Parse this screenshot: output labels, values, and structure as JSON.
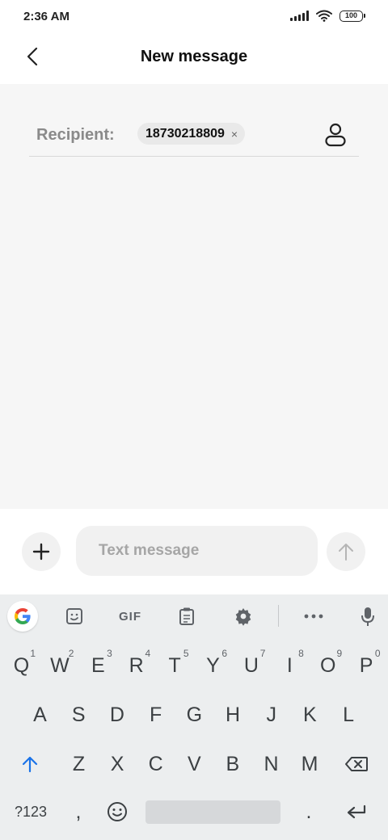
{
  "status_bar": {
    "time": "2:36 AM",
    "battery": "100"
  },
  "header": {
    "title": "New message"
  },
  "recipient": {
    "label": "Recipient:",
    "number": "18730218809",
    "remove_glyph": "×"
  },
  "composer": {
    "placeholder": "Text message"
  },
  "keyboard": {
    "toolbar": {
      "gif_label": "GIF"
    },
    "row1": [
      {
        "label": "Q",
        "hint": "1"
      },
      {
        "label": "W",
        "hint": "2"
      },
      {
        "label": "E",
        "hint": "3"
      },
      {
        "label": "R",
        "hint": "4"
      },
      {
        "label": "T",
        "hint": "5"
      },
      {
        "label": "Y",
        "hint": "6"
      },
      {
        "label": "U",
        "hint": "7"
      },
      {
        "label": "I",
        "hint": "8"
      },
      {
        "label": "O",
        "hint": "9"
      },
      {
        "label": "P",
        "hint": "0"
      }
    ],
    "row2": [
      "A",
      "S",
      "D",
      "F",
      "G",
      "H",
      "J",
      "K",
      "L"
    ],
    "row3": [
      "Z",
      "X",
      "C",
      "V",
      "B",
      "N",
      "M"
    ],
    "symbols_label": "?123",
    "comma_label": ",",
    "period_label": "."
  },
  "colors": {
    "accent_blue": "#1a73e8",
    "background": "#f6f6f6",
    "keyboard": "#eceeef"
  }
}
